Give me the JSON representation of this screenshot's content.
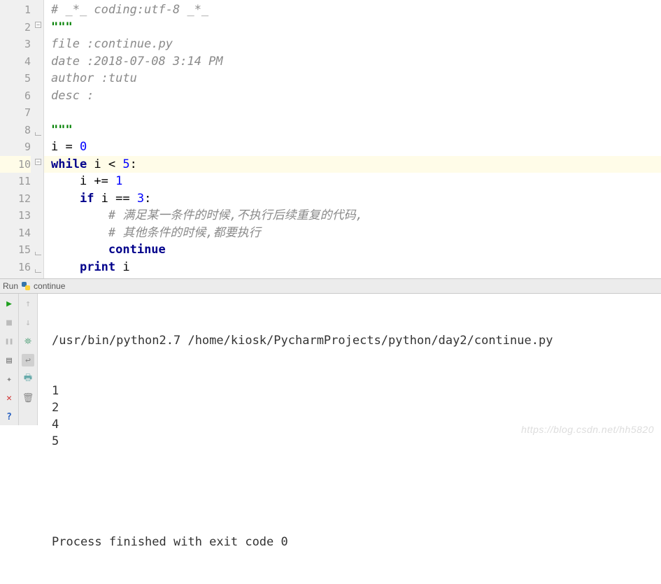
{
  "editor": {
    "gutter_numbers": [
      "1",
      "2",
      "3",
      "4",
      "5",
      "6",
      "7",
      "8",
      "9",
      "10",
      "11",
      "12",
      "13",
      "14",
      "15",
      "16"
    ],
    "highlighted_line_index": 9,
    "code_tokens": [
      [
        {
          "cls": "comment",
          "t": "# _*_ coding:utf-8 _*_"
        }
      ],
      [
        {
          "cls": "strq",
          "t": "\"\"\""
        }
      ],
      [
        {
          "cls": "comment",
          "t": "file :continue.py"
        }
      ],
      [
        {
          "cls": "comment",
          "t": "date :2018-07-08 3:14 PM"
        }
      ],
      [
        {
          "cls": "comment",
          "t": "author :tutu"
        }
      ],
      [
        {
          "cls": "comment",
          "t": "desc :"
        }
      ],
      [],
      [
        {
          "cls": "strq",
          "t": "\"\"\""
        }
      ],
      [
        {
          "cls": "",
          "t": "i = "
        },
        {
          "cls": "num",
          "t": "0"
        }
      ],
      [
        {
          "cls": "kw",
          "t": "while"
        },
        {
          "cls": "",
          "t": " i < "
        },
        {
          "cls": "num",
          "t": "5"
        },
        {
          "cls": "",
          "t": ":"
        }
      ],
      [
        {
          "cls": "",
          "t": "    i += "
        },
        {
          "cls": "num",
          "t": "1"
        }
      ],
      [
        {
          "cls": "",
          "t": "    "
        },
        {
          "cls": "kw",
          "t": "if"
        },
        {
          "cls": "",
          "t": " i == "
        },
        {
          "cls": "num",
          "t": "3"
        },
        {
          "cls": "",
          "t": ":"
        }
      ],
      [
        {
          "cls": "",
          "t": "        "
        },
        {
          "cls": "comment",
          "t": "# 满足某一条件的时候,不执行后续重复的代码,"
        }
      ],
      [
        {
          "cls": "",
          "t": "        "
        },
        {
          "cls": "comment",
          "t": "# 其他条件的时候,都要执行"
        }
      ],
      [
        {
          "cls": "",
          "t": "        "
        },
        {
          "cls": "kw",
          "t": "continue"
        }
      ],
      [
        {
          "cls": "",
          "t": "    "
        },
        {
          "cls": "kw",
          "t": "print"
        },
        {
          "cls": "",
          "t": " i"
        }
      ]
    ]
  },
  "run_tab": {
    "label": "Run",
    "config_name": "continue"
  },
  "console": {
    "command": "/usr/bin/python2.7 /home/kiosk/PycharmProjects/python/day2/continue.py",
    "output_lines": [
      "1",
      "2",
      "4",
      "5"
    ],
    "exit_msg": "Process finished with exit code 0"
  },
  "watermark": "https://blog.csdn.net/hh5820",
  "icons": {
    "play": "▶",
    "stop": "■",
    "pause": "❚❚",
    "layout": "▤",
    "pin": "✦",
    "close_x": "✕",
    "help": "?",
    "up": "↑",
    "down": "↓",
    "wrap": "↩",
    "print": "🖶",
    "trash": "🗑",
    "gear": "⛯"
  }
}
